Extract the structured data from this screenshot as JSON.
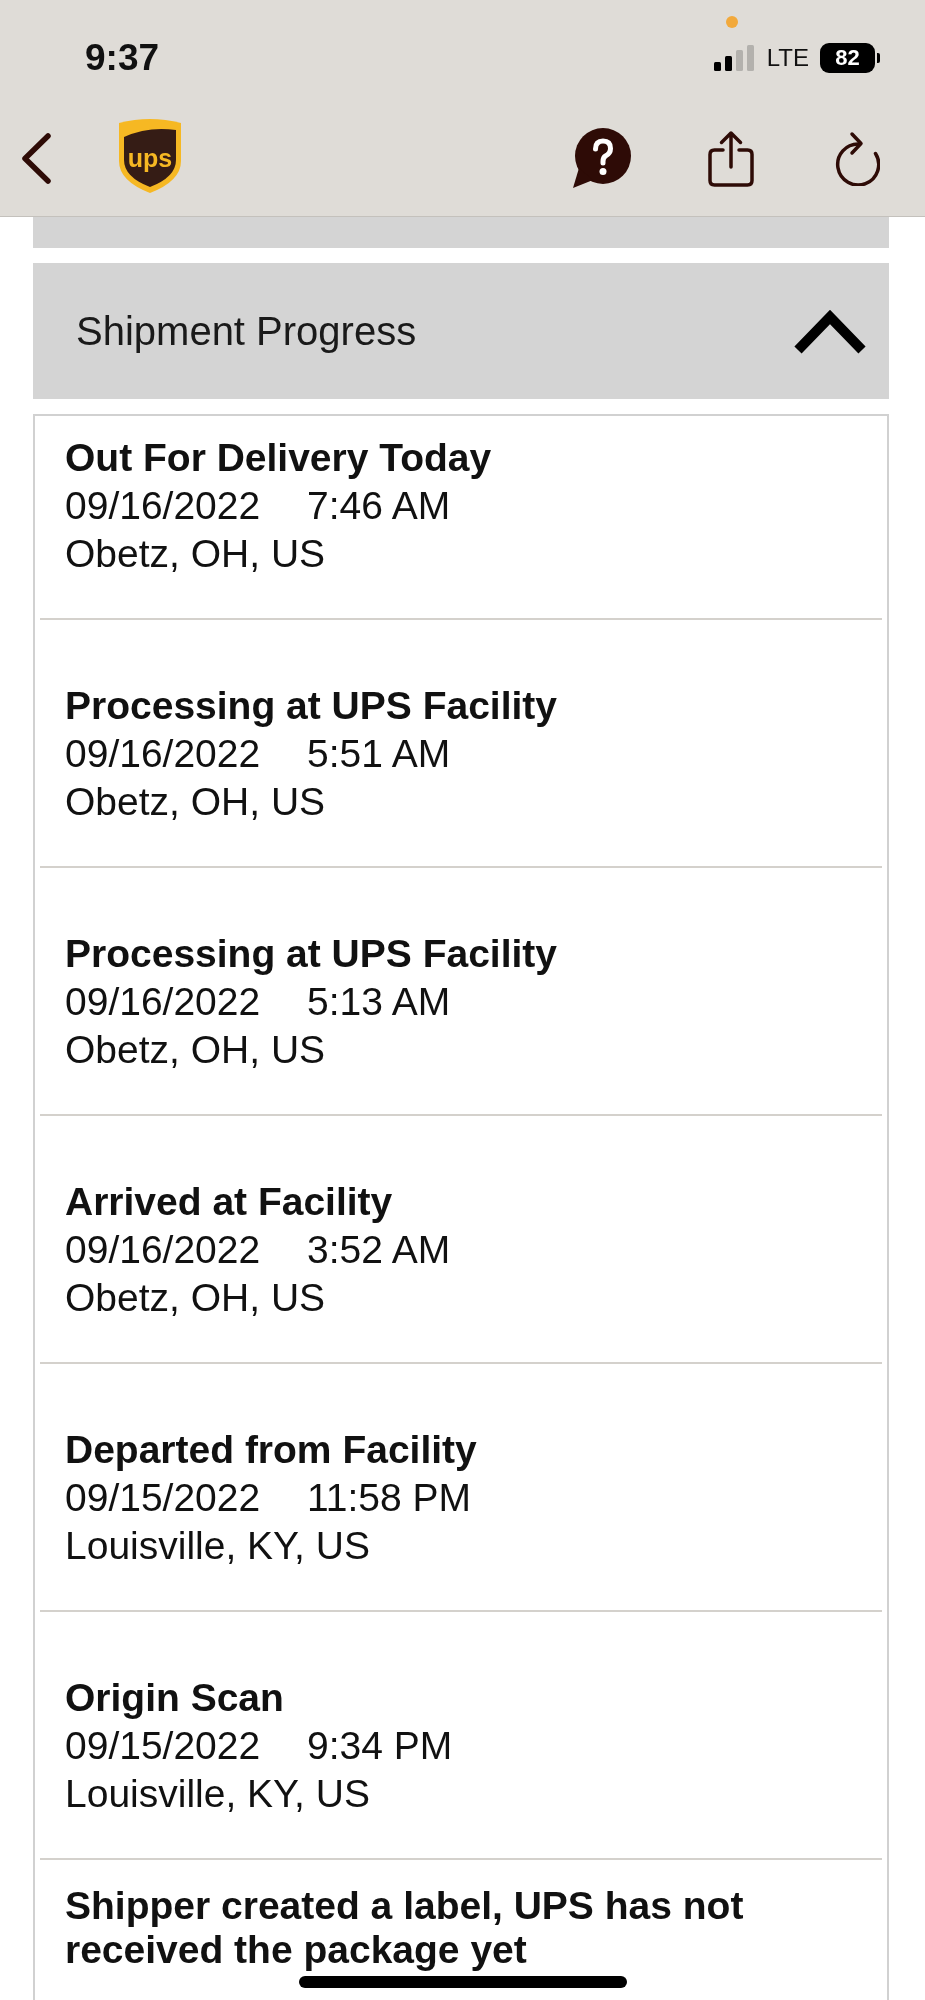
{
  "status_bar": {
    "time": "9:37",
    "network": "LTE",
    "battery": "82"
  },
  "nav_bar": {
    "logo": "ups"
  },
  "shipment_progress": {
    "title": "Shipment Progress",
    "expanded": true,
    "events": [
      {
        "status": "Out For Delivery Today",
        "date": "09/16/2022",
        "time": "7:46 AM",
        "location": "Obetz, OH, US"
      },
      {
        "status": "Processing at UPS Facility",
        "date": "09/16/2022",
        "time": "5:51 AM",
        "location": "Obetz, OH, US"
      },
      {
        "status": "Processing at UPS Facility",
        "date": "09/16/2022",
        "time": "5:13 AM",
        "location": "Obetz, OH, US"
      },
      {
        "status": "Arrived at Facility",
        "date": "09/16/2022",
        "time": "3:52 AM",
        "location": "Obetz, OH, US"
      },
      {
        "status": "Departed from Facility",
        "date": "09/15/2022",
        "time": "11:58 PM",
        "location": "Louisville, KY, US"
      },
      {
        "status": "Origin Scan",
        "date": "09/15/2022",
        "time": "9:34 PM",
        "location": "Louisville, KY, US"
      },
      {
        "status": "Shipper created a label, UPS has not received the package yet"
      }
    ]
  }
}
